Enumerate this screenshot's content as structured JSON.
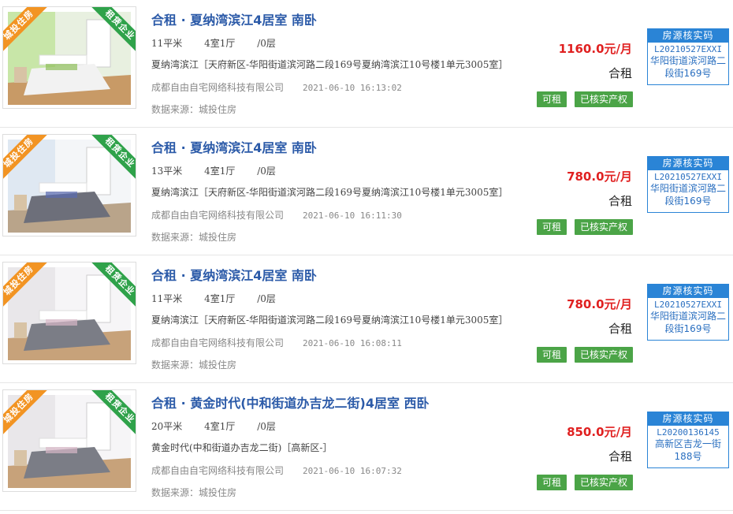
{
  "listings": [
    {
      "ribbon_left": "城投住房",
      "ribbon_right": "租赁企业",
      "title": "合租 · 夏纳湾滨江4居室 南卧",
      "area": "11平米",
      "layout": "4室1厅",
      "floor": "/0层",
      "address": "夏纳湾滨江［天府新区-华阳街道滨河路二段169号夏纳湾滨江10号楼1单元3005室］",
      "company": "成都自由自宅网络科技有限公司",
      "time": "2021-06-10 16:13:02",
      "source": "数据来源：城投住房",
      "price": "1160.0元/月",
      "rent_type": "合租",
      "badge_available": "可租",
      "badge_verified": "已核实产权",
      "verify_title": "房源核实码",
      "verify_code": "L20210527EXXI",
      "verify_location": "华阳街道滨河路二段街169号",
      "photo_theme": "green"
    },
    {
      "ribbon_left": "城投住房",
      "ribbon_right": "租赁企业",
      "title": "合租 · 夏纳湾滨江4居室 南卧",
      "area": "13平米",
      "layout": "4室1厅",
      "floor": "/0层",
      "address": "夏纳湾滨江［天府新区-华阳街道滨河路二段169号夏纳湾滨江10号楼1单元3005室］",
      "company": "成都自由自宅网络科技有限公司",
      "time": "2021-06-10 16:11:30",
      "source": "数据来源：城投住房",
      "price": "780.0元/月",
      "rent_type": "合租",
      "badge_available": "可租",
      "badge_verified": "已核实产权",
      "verify_title": "房源核实码",
      "verify_code": "L20210527EXXI",
      "verify_location": "华阳街道滨河路二段街169号",
      "photo_theme": "blue"
    },
    {
      "ribbon_left": "城投住房",
      "ribbon_right": "租赁企业",
      "title": "合租 · 夏纳湾滨江4居室 南卧",
      "area": "11平米",
      "layout": "4室1厅",
      "floor": "/0层",
      "address": "夏纳湾滨江［天府新区-华阳街道滨河路二段169号夏纳湾滨江10号楼1单元3005室］",
      "company": "成都自由自宅网络科技有限公司",
      "time": "2021-06-10 16:08:11",
      "source": "数据来源：城投住房",
      "price": "780.0元/月",
      "rent_type": "合租",
      "badge_available": "可租",
      "badge_verified": "已核实产权",
      "verify_title": "房源核实码",
      "verify_code": "L20210527EXXI",
      "verify_location": "华阳街道滨河路二段街169号",
      "photo_theme": "grey"
    },
    {
      "ribbon_left": "城投住房",
      "ribbon_right": "租赁企业",
      "title": "合租 · 黄金时代(中和街道办吉龙二街)4居室 西卧",
      "area": "20平米",
      "layout": "4室1厅",
      "floor": "/0层",
      "address": "黄金时代(中和街道办吉龙二街)［高新区-］",
      "company": "成都自由自宅网络科技有限公司",
      "time": "2021-06-10 16:07:32",
      "source": "数据来源：城投住房",
      "price": "850.0元/月",
      "rent_type": "合租",
      "badge_available": "可租",
      "badge_verified": "已核实产权",
      "verify_title": "房源核实码",
      "verify_code": "L20200136145",
      "verify_location": "高新区吉龙一街188号",
      "photo_theme": "grey"
    }
  ]
}
